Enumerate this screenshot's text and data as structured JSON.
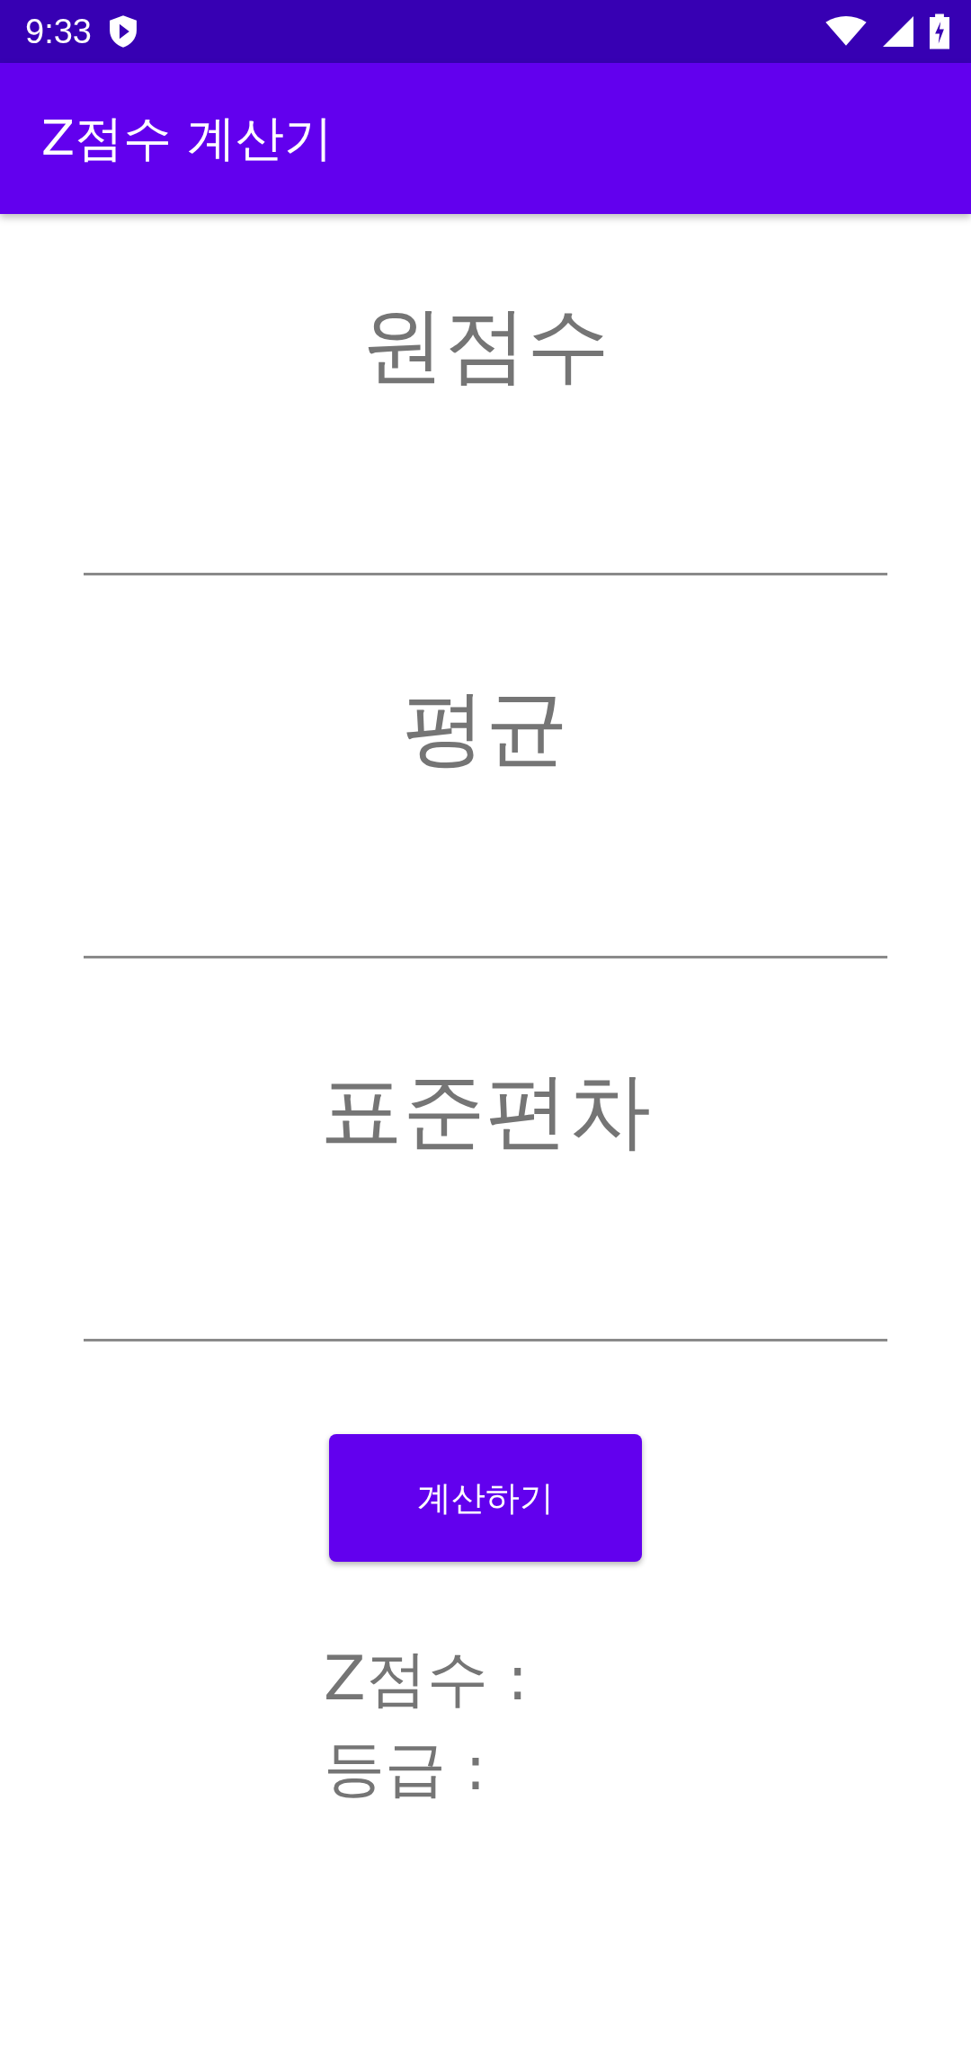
{
  "status_bar": {
    "time": "9:33"
  },
  "app_bar": {
    "title": "Z점수 계산기"
  },
  "fields": [
    {
      "placeholder": "원점수"
    },
    {
      "placeholder": "평균"
    },
    {
      "placeholder": "표준편차"
    }
  ],
  "button": {
    "label": "계산하기"
  },
  "results": [
    "Z점수 :",
    "등급 :"
  ]
}
